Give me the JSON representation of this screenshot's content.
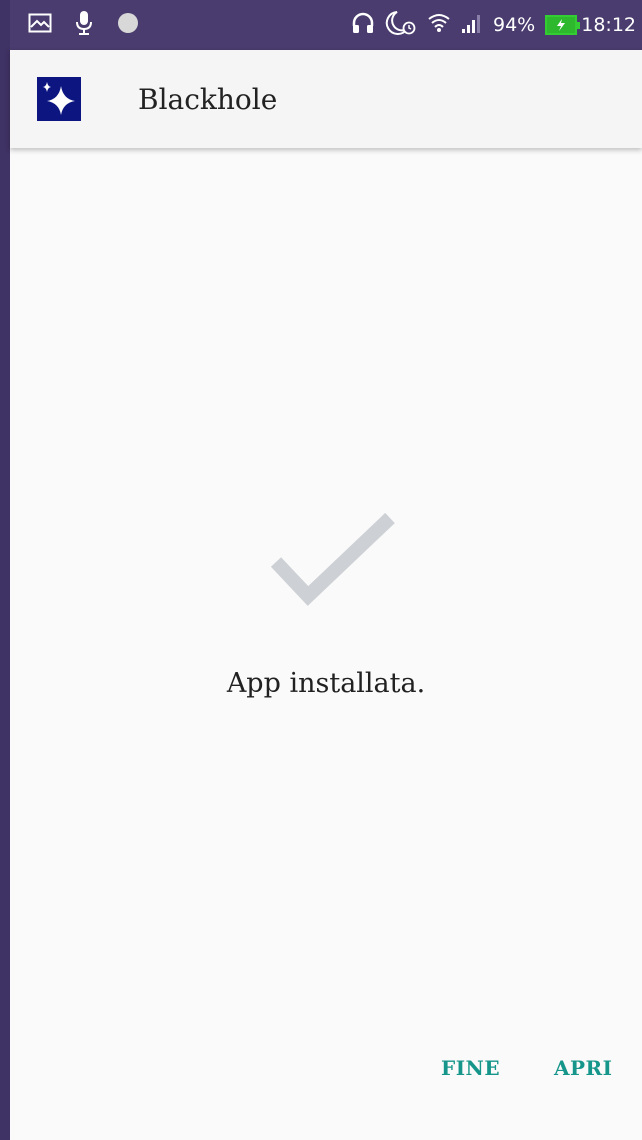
{
  "status_bar": {
    "icons_left": [
      "image-icon",
      "microphone-icon",
      "circle-icon"
    ],
    "icons_right": [
      "headphones-icon",
      "moon-alarm-icon",
      "wifi-icon",
      "signal-icon"
    ],
    "battery_percent": "94%",
    "battery_level": 0.94,
    "time": "18:12"
  },
  "app_bar": {
    "icon": "sparkle-icon",
    "title": "Blackhole"
  },
  "main": {
    "status_icon": "check-icon",
    "message": "App installata."
  },
  "actions": {
    "done_label": "FINE",
    "open_label": "APRI"
  },
  "colors": {
    "accent": "#16968a",
    "app_icon_bg": "#0d1680",
    "statusbar_bg": "#4a3c6e",
    "check": "#cdd0d4"
  }
}
